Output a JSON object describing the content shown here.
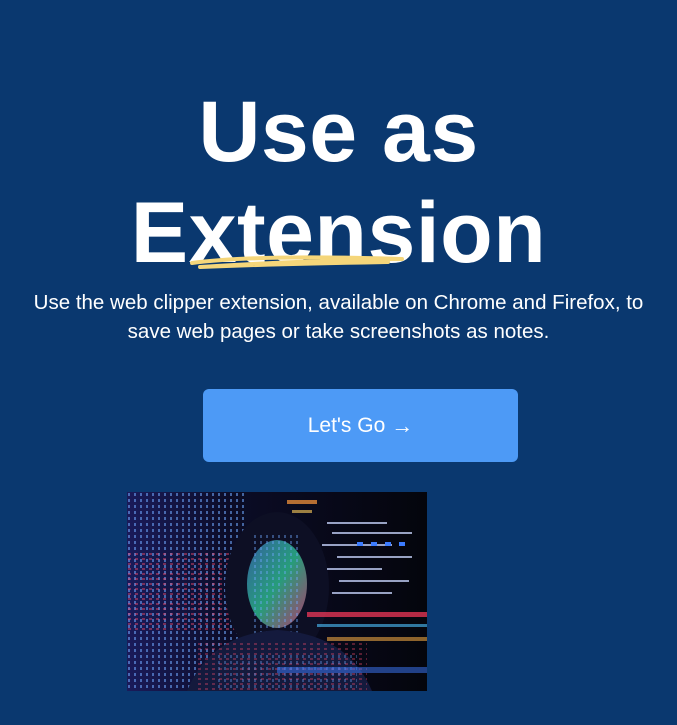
{
  "hero": {
    "title_line1": "Use as",
    "title_line2": "Extension",
    "subtitle": "Use the web clipper extension, available on Chrome and Firefox, to save web pages or take screenshots as notes."
  },
  "cta": {
    "label": "Let's Go",
    "arrow": "→"
  },
  "colors": {
    "background": "#0a386f",
    "button": "#4d9af6",
    "underline": "#f5d67a"
  },
  "image": {
    "subject": "woman with code projected on face"
  }
}
